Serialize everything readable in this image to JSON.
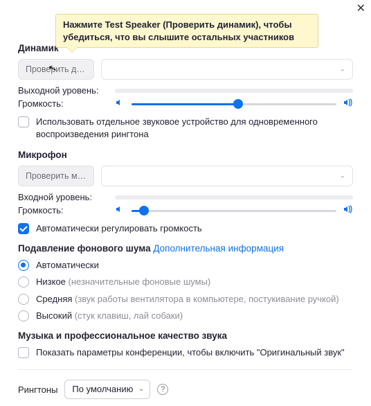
{
  "close_icon": "✕",
  "tooltip": "Нажмите Test Speaker (Проверить динамик), чтобы убедиться, что вы слышите остальных участников",
  "speaker": {
    "title": "Динамик",
    "test_btn": "Проверить ди…",
    "output_level_label": "Выходной уровень:",
    "volume_label": "Громкость:",
    "volume_percent": 52,
    "separate_ringer": "Использовать отдельное звуковое устройство для одновременного воспроизведения рингтона"
  },
  "mic": {
    "title": "Микрофон",
    "test_btn": "Проверить м…",
    "input_level_label": "Входной уровень:",
    "volume_label": "Громкость:",
    "volume_percent": 6,
    "auto_adjust": "Автоматически регулировать громкость"
  },
  "noise": {
    "heading": "Подавление фонового шума",
    "more_info": "Дополнительная информация",
    "options": [
      {
        "label": "Автоматически",
        "hint": "",
        "checked": true
      },
      {
        "label": "Низкое",
        "hint": "(незначительные фоновые шумы)",
        "checked": false
      },
      {
        "label": "Средняя",
        "hint": "(звук работы вентилятора в компьютере, постукивание ручкой)",
        "checked": false
      },
      {
        "label": "Высокий",
        "hint": "(стук клавиш, лай собаки)",
        "checked": false
      }
    ]
  },
  "music": {
    "heading": "Музыка и профессиональное качество звука",
    "original_sound": "Показать параметры конференции, чтобы включить \"Оригинальный звук\""
  },
  "ringtone": {
    "label": "Рингтоны",
    "value": "По умолчанию"
  },
  "icons": {
    "chevron": "⌄",
    "vol_low": "◀",
    "vol_high": "▶",
    "help": "?"
  }
}
